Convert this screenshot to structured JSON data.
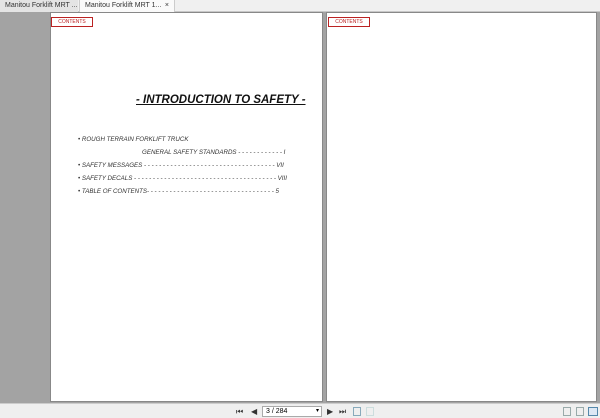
{
  "tabs": [
    {
      "label": "Manitou Forklift MRT ..."
    },
    {
      "label": "Manitou Forklift MRT 1...",
      "close": "×"
    }
  ],
  "pages": {
    "left": {
      "contents_button": "CONTENTS",
      "title": "- INTRODUCTION TO SAFETY -",
      "toc": [
        {
          "text": "• ROUGH TERRAIN FORKLIFT TRUCK"
        },
        {
          "text": "GENERAL SAFETY STANDARDS - - - - - - - - - - - -   I"
        },
        {
          "text": "• SAFETY MESSAGES - - - - - - - - - - - - - - - - - - - - - - - - - - - - - - - - - - - VII"
        },
        {
          "text": "• SAFETY DECALS - - - - - - - - - - - - - - - - - - - - - - - - - - - - - - - - - - - - - - VIII"
        },
        {
          "text": "• TABLE OF CONTENTS- - - - - - - - - - - - - - - - - - - - - - - - - - - - - - - - - - 5"
        }
      ]
    },
    "right": {
      "contents_button": "CONTENTS"
    }
  },
  "nav": {
    "first": "⏮",
    "prev": "◀",
    "page_value": "3 / 284",
    "dropdown": "▾",
    "next": "▶",
    "last": "⏭"
  }
}
